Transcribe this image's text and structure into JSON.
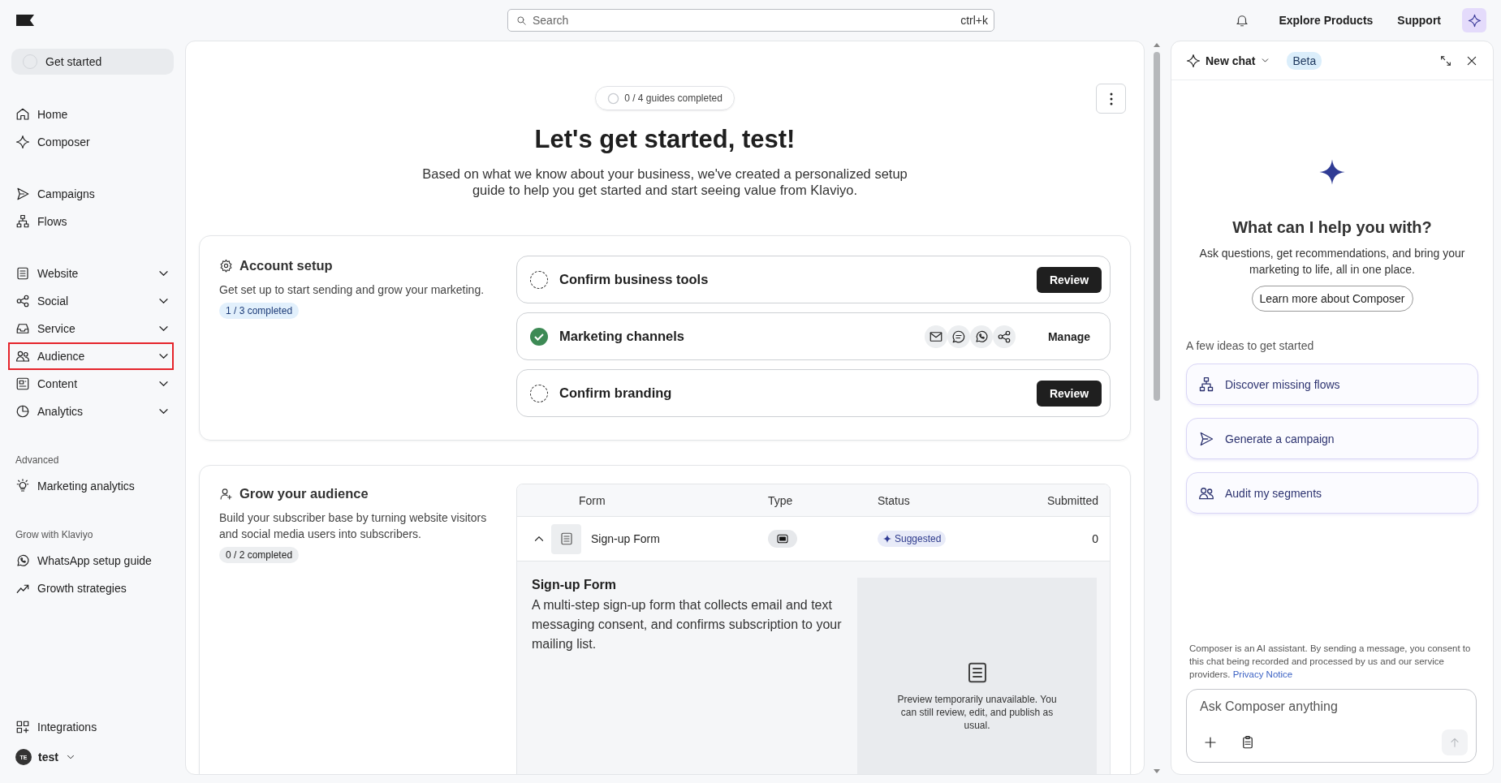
{
  "topbar": {
    "search": {
      "placeholder": "Search",
      "shortcut": "ctrl+k"
    },
    "links": [
      "Explore Products",
      "Support"
    ]
  },
  "sidebar": {
    "get_started": {
      "label": "Get started",
      "selected": true
    },
    "sections": [
      {
        "items": [
          {
            "label": "Home",
            "expandable": false,
            "selected": false,
            "highlighted": false
          },
          {
            "label": "Composer",
            "expandable": false,
            "selected": false,
            "highlighted": false
          }
        ]
      },
      {
        "items": [
          {
            "label": "Campaigns",
            "expandable": false,
            "selected": false,
            "highlighted": false
          },
          {
            "label": "Flows",
            "expandable": false,
            "selected": false,
            "highlighted": false
          }
        ]
      },
      {
        "items": [
          {
            "label": "Website",
            "expandable": true,
            "selected": false,
            "highlighted": false
          },
          {
            "label": "Social",
            "expandable": true,
            "selected": false,
            "highlighted": false
          },
          {
            "label": "Service",
            "expandable": true,
            "selected": false,
            "highlighted": false
          },
          {
            "label": "Audience",
            "expandable": true,
            "selected": false,
            "highlighted": true
          },
          {
            "label": "Content",
            "expandable": true,
            "selected": false,
            "highlighted": false
          },
          {
            "label": "Analytics",
            "expandable": true,
            "selected": false,
            "highlighted": false
          }
        ]
      },
      {
        "heading": "Advanced",
        "items": [
          {
            "label": "Marketing analytics",
            "expandable": false,
            "selected": false,
            "highlighted": false
          }
        ]
      },
      {
        "heading": "Grow with Klaviyo",
        "items": [
          {
            "label": "WhatsApp setup guide",
            "expandable": false,
            "selected": false,
            "highlighted": false
          },
          {
            "label": "Growth strategies",
            "expandable": false,
            "selected": false,
            "highlighted": false
          }
        ]
      }
    ],
    "footer_items": [
      {
        "label": "Integrations",
        "expandable": false,
        "selected": false,
        "highlighted": false
      }
    ],
    "user": {
      "initials": "TE",
      "name": "test"
    }
  },
  "main": {
    "guides": {
      "label": "0 / 4 guides completed",
      "level": 0
    },
    "title": "Let's get started, test!",
    "description": "Based on what we know about your business, we've created a personalized setup guide to help you get started and start seeing value from Klaviyo.",
    "account_setup": {
      "title": "Account setup",
      "description": "Get set up to start sending and grow your marketing.",
      "progress": "1 / 3 completed",
      "started": true,
      "tasks": [
        {
          "label": "Confirm business tools",
          "completed": false,
          "channel_icons": false,
          "action": "Review",
          "action_primary": true
        },
        {
          "label": "Marketing channels",
          "completed": true,
          "channel_icons": true,
          "action": "Manage",
          "action_primary": false
        },
        {
          "label": "Confirm branding",
          "completed": false,
          "channel_icons": false,
          "action": "Review",
          "action_primary": true
        }
      ]
    },
    "grow_audience": {
      "title": "Grow your audience",
      "description": "Build your subscriber base by turning website visitors and social media users into subscribers.",
      "progress": "0 / 2 completed",
      "started": false,
      "table": {
        "columns": [
          "Form",
          "Type",
          "Status",
          "Submitted"
        ],
        "rows": [
          {
            "expanded": true,
            "name": "Sign-up Form",
            "status": "Suggested",
            "submitted": "0",
            "detail": {
              "title": "Sign-up Form",
              "description": "A multi-step sign-up form that collects email and text messaging consent, and confirms subscription to your mailing list.",
              "preview_note": "Preview temporarily unavailable. You can still review, edit, and publish as usual."
            }
          }
        ]
      }
    }
  },
  "chat": {
    "title": "New chat",
    "badge": "Beta",
    "heading": "What can I help you with?",
    "subtitle": "Ask questions, get recommendations, and bring your marketing to life, all in one place.",
    "learn_more": "Learn more about Composer",
    "ideas_heading": "A few ideas to get started",
    "ideas": [
      "Discover missing flows",
      "Generate a campaign",
      "Audit my segments"
    ],
    "disclaimer": "Composer is an AI assistant. By sending a message, you consent to this chat being recorded and processed by us and our service providers.",
    "privacy_link": "Privacy Notice",
    "input_placeholder": "Ask Composer anything"
  }
}
